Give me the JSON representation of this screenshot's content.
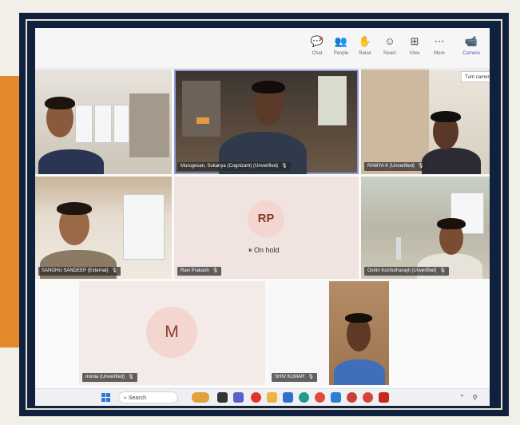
{
  "toolbar": {
    "items": [
      {
        "label": "Chat",
        "icon": "chat-icon",
        "glyph": "💬"
      },
      {
        "label": "People",
        "icon": "people-icon",
        "glyph": "👥"
      },
      {
        "label": "Raise",
        "icon": "raise-hand-icon",
        "glyph": "✋"
      },
      {
        "label": "React",
        "icon": "react-icon",
        "glyph": "☺"
      },
      {
        "label": "View",
        "icon": "view-icon",
        "glyph": "⊞"
      },
      {
        "label": "More",
        "icon": "more-icon",
        "glyph": "⋯"
      },
      {
        "label": "Camera",
        "icon": "camera-icon",
        "glyph": "📹"
      }
    ],
    "tooltip": "Turn camera"
  },
  "participants": [
    {
      "name": ""
    },
    {
      "name": "Murugesan, Sukanya (Cognizant) (Unverified)"
    },
    {
      "name": "RAMYA K (Unverified)"
    },
    {
      "name": "SANGHU SANDEEP (External)"
    },
    {
      "name": "Ravi Prakash",
      "initials": "RP",
      "status": "On hold"
    },
    {
      "name": "Oshin Kochutharayil (Unverified)"
    },
    {
      "name": "monia (Unverified)",
      "initials": "M"
    },
    {
      "name": "SHIV KUMAR"
    }
  ],
  "taskbar": {
    "search_placeholder": "Search"
  },
  "colors": {
    "frame": "#10203f",
    "accent_orange": "#e48a2c",
    "teams_purple": "#4b5bb8",
    "avatar_bg": "#f2d6cf",
    "avatar_text": "#8a3b2c"
  }
}
